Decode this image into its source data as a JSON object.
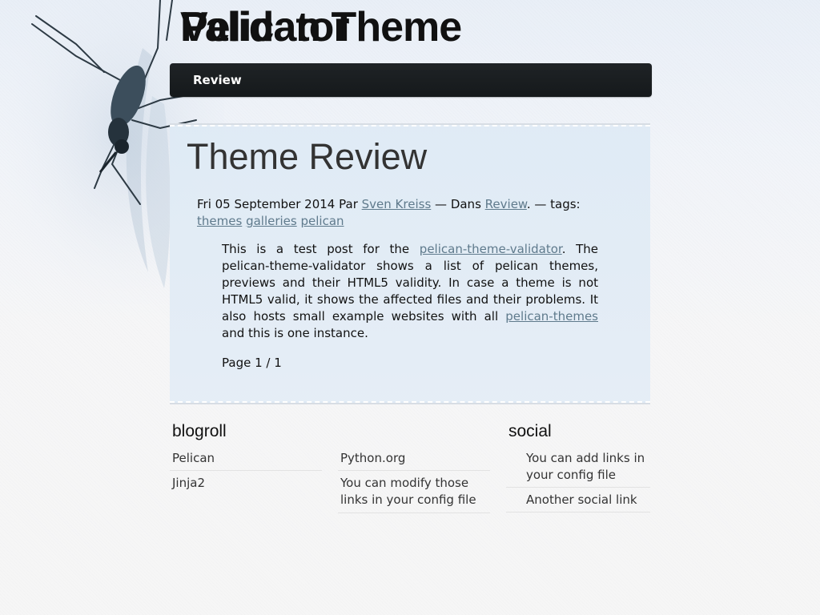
{
  "site": {
    "title_layer_1": "Pelican Theme",
    "title_layer_2": "Validator"
  },
  "nav": {
    "items": [
      {
        "label": "Review"
      }
    ]
  },
  "article": {
    "title": "Theme Review",
    "date": "Fri 05 September 2014",
    "by_label": "Par",
    "author": "Sven Kreiss",
    "in_label": "— Dans",
    "category": "Review",
    "tags_label": ". — tags:",
    "tags": [
      "themes",
      "galleries",
      "pelican"
    ],
    "body": {
      "part1": "This is a test post for the",
      "link1": "pelican-theme-validator",
      "part2": ". The pelican-theme-validator shows a list of pelican themes, previews and their HTML5 validity. In case a theme is not HTML5 valid, it shows the affected files and their problems. It also hosts small example websites with all",
      "link2": "pelican-themes",
      "part3": "and this is one instance."
    },
    "pagination": "Page 1 / 1"
  },
  "blogroll": {
    "title": "blogroll",
    "links": [
      "Pelican",
      "Python.org",
      "Jinja2",
      "You can modify those links in your config file"
    ]
  },
  "social": {
    "title": "social",
    "links": [
      "You can add links in your config file",
      "Another social link"
    ]
  },
  "colors": {
    "navbar": "#1a1e20",
    "link": "#5f7a8c",
    "panel": "#e3edf6"
  }
}
